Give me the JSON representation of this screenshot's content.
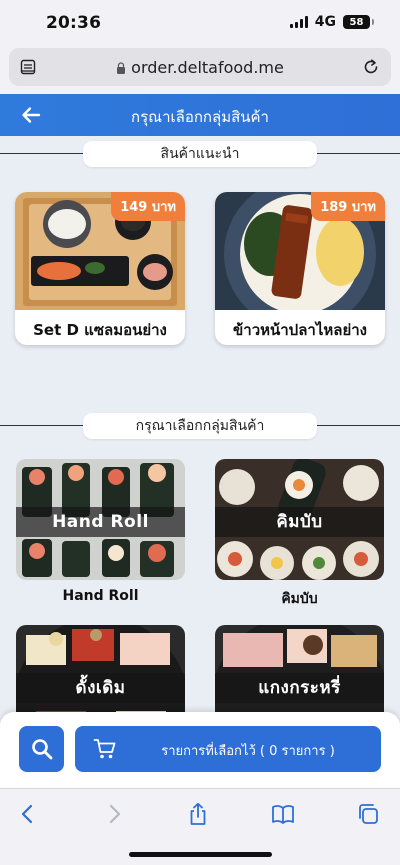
{
  "status_bar": {
    "time": "20:36",
    "network": "4G",
    "battery": "58"
  },
  "browser": {
    "url": "order.deltafood.me"
  },
  "header": {
    "title": "กรุณาเลือกกลุ่มสินค้า"
  },
  "recommended": {
    "title": "สินค้าแนะนำ",
    "items": [
      {
        "name": "Set D แซลมอนย่าง",
        "price": "149 บาท"
      },
      {
        "name": "ข้าวหน้าปลาไหลย่าง",
        "price": "189 บาท"
      }
    ]
  },
  "categories": {
    "title": "กรุณาเลือกกลุ่มสินค้า",
    "items": [
      {
        "banner": "Hand Roll",
        "label": "Hand Roll"
      },
      {
        "banner": "คิมบับ",
        "label": "คิมบับ"
      },
      {
        "banner": "ดั้งเดิม",
        "label": ""
      },
      {
        "banner": "แกงกระหรี่",
        "label": ""
      }
    ]
  },
  "cart": {
    "label": "รายการที่เลือกไว้ ( 0 รายการ )"
  },
  "colors": {
    "primary": "#2d6fd6",
    "price_badge": "#f07f3c",
    "background": "#e9edf4"
  },
  "icons": [
    "reader-icon",
    "lock-icon",
    "reload-icon",
    "back-arrow-icon",
    "search-icon",
    "cart-icon",
    "browser-back-icon",
    "browser-forward-icon",
    "share-icon",
    "bookmarks-icon",
    "tabs-icon"
  ]
}
